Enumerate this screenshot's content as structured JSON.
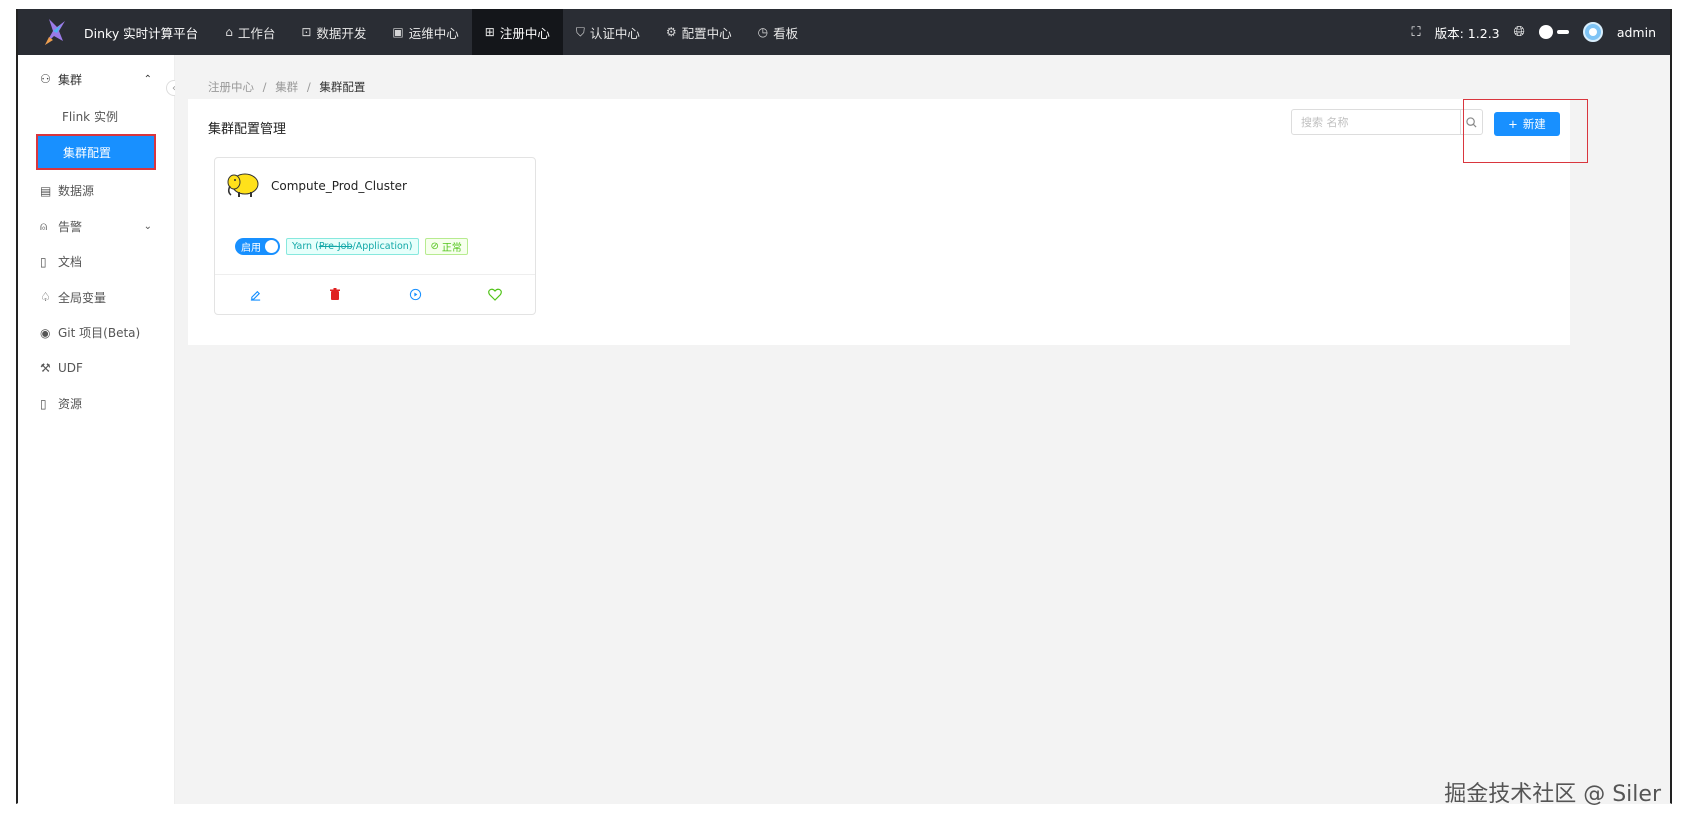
{
  "app": {
    "brand": "Dinky 实时计算平台",
    "version_label": "版本: 1.2.3",
    "user": "admin"
  },
  "nav": {
    "items": [
      {
        "label": "工作台",
        "icon": "home-icon"
      },
      {
        "label": "数据开发",
        "icon": "terminal-icon"
      },
      {
        "label": "运维中心",
        "icon": "monitor-icon"
      },
      {
        "label": "注册中心",
        "icon": "apps-icon"
      },
      {
        "label": "认证中心",
        "icon": "shield-icon"
      },
      {
        "label": "配置中心",
        "icon": "gear-icon"
      },
      {
        "label": "看板",
        "icon": "dashboard-icon"
      }
    ],
    "active": "注册中心"
  },
  "sidebar": {
    "group": "集群",
    "sub_items": [
      "Flink 实例",
      "集群配置"
    ],
    "selected": "集群配置",
    "items": [
      {
        "label": "数据源",
        "icon": "database-icon"
      },
      {
        "label": "告警",
        "icon": "alarm-icon"
      },
      {
        "label": "文档",
        "icon": "file-icon"
      },
      {
        "label": "全局变量",
        "icon": "variable-icon"
      },
      {
        "label": "Git 项目(Beta)",
        "icon": "github-icon"
      },
      {
        "label": "UDF",
        "icon": "tool-icon"
      },
      {
        "label": "资源",
        "icon": "resource-icon"
      }
    ]
  },
  "breadcrumb": [
    "注册中心",
    "集群",
    "集群配置"
  ],
  "page": {
    "title": "集群配置管理",
    "search_placeholder": "搜索 名称",
    "new_button": "新建"
  },
  "cluster_card": {
    "name": "Compute_Prod_Cluster",
    "enabled_label": "启用",
    "type_prefix": "Yarn (",
    "type_struck": "Pre-Job",
    "type_suffix": "/Application)",
    "status": "正常"
  },
  "watermark": "掘金技术社区 @ Siler"
}
